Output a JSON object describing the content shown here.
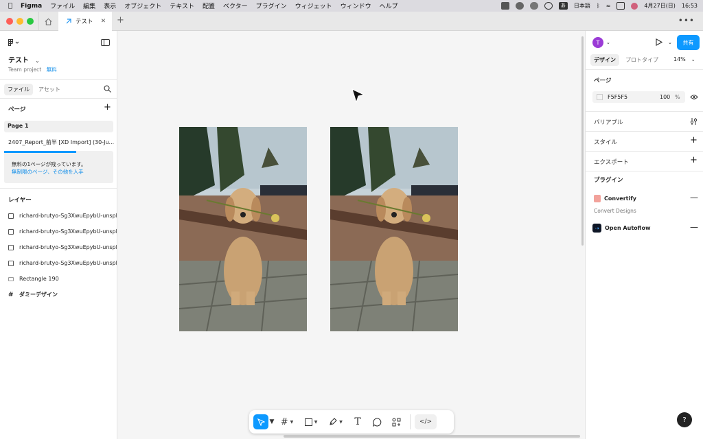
{
  "menubar": {
    "app": "Figma",
    "items": [
      "ファイル",
      "編集",
      "表示",
      "オブジェクト",
      "テキスト",
      "配置",
      "ベクター",
      "プラグイン",
      "ウィジェット",
      "ウィンドウ",
      "ヘルプ"
    ],
    "ime_badge": "あ",
    "ime_label": "日本語",
    "date": "4月27日(日)",
    "time": "16:53"
  },
  "tabs": {
    "file_tab": "テスト"
  },
  "left": {
    "project_name": "テスト",
    "team": "Team project",
    "plan": "無料",
    "tab_file": "ファイル",
    "tab_assets": "アセット",
    "pages_header": "ページ",
    "pages": [
      "Page 1",
      "2407_Report_前半 [XD Import] (30-Ju..."
    ],
    "notice_line1": "無料の1ページが残っています。",
    "notice_line2": "無制限のページ、その他を入手",
    "layers_header": "レイヤー",
    "layers": [
      "richard-brutyo-Sg3XwuEpybU-unsplash",
      "richard-brutyo-Sg3XwuEpybU-unsplash",
      "richard-brutyo-Sg3XwuEpybU-unsplash",
      "richard-brutyo-Sg3XwuEpybU-unsplash",
      "Rectangle 190",
      "ダミーデザイン"
    ]
  },
  "right": {
    "avatar": "T",
    "share": "共有",
    "tab_design": "デザイン",
    "tab_prototype": "プロトタイプ",
    "zoom": "14%",
    "page_section": "ページ",
    "bg_color": "F5F5F5",
    "bg_opacity": "100",
    "percent": "%",
    "variables": "バリアブル",
    "styles": "スタイル",
    "export": "エクスポート",
    "plugins": "プラグイン",
    "plugin1": "Convertify",
    "plugin1_cmd": "Convert Designs",
    "plugin2": "Open Autoflow"
  },
  "help": "?",
  "colors": {
    "accent": "#0d99ff",
    "close": "#fe5f57",
    "minimize": "#febc2e",
    "maximize": "#28c840"
  },
  "icons": [
    "apple-icon",
    "home-icon",
    "figma-file-icon",
    "close-icon",
    "plus-icon",
    "figma-logo-icon",
    "panel-toggle-icon",
    "search-icon",
    "image-layer-icon",
    "rectangle-icon",
    "frame-icon",
    "play-icon",
    "eye-icon",
    "adjust-icon",
    "move-tool-icon",
    "frame-tool-icon",
    "shape-tool-icon",
    "pen-tool-icon",
    "text-tool-icon",
    "comment-tool-icon",
    "actions-icon",
    "dev-mode-icon",
    "help-icon"
  ]
}
